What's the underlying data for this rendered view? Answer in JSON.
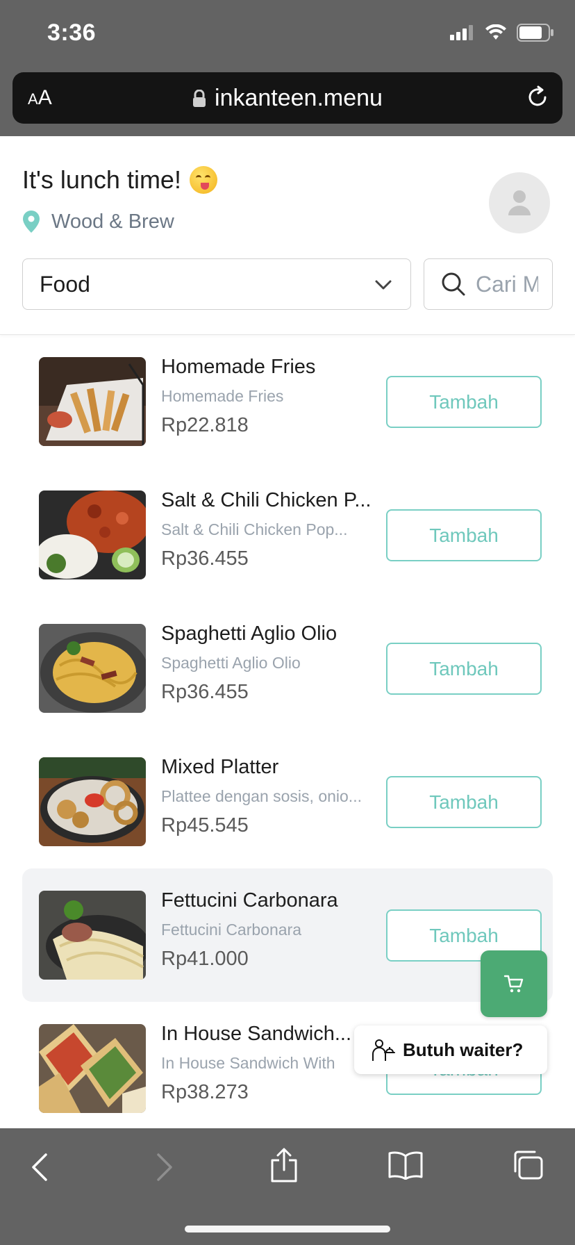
{
  "status_bar": {
    "time": "3:36"
  },
  "browser": {
    "text_size_label_small": "A",
    "text_size_label_large": "A",
    "url": "inkanteen.menu"
  },
  "header": {
    "greeting": "It's lunch time!",
    "location": "Wood & Brew",
    "category_selected": "Food",
    "search_placeholder": "Cari Menu"
  },
  "menu_items": [
    {
      "name": "Homemade Fries",
      "desc": "Homemade Fries",
      "price": "Rp22.818",
      "button": "Tambah",
      "image": "fries-photo"
    },
    {
      "name": "Salt & Chili Chicken P...",
      "desc": "Salt & Chili Chicken Pop...",
      "price": "Rp36.455",
      "button": "Tambah",
      "image": "chicken-rice-photo"
    },
    {
      "name": "Spaghetti Aglio Olio",
      "desc": "Spaghetti Aglio Olio",
      "price": "Rp36.455",
      "button": "Tambah",
      "image": "spaghetti-photo"
    },
    {
      "name": "Mixed Platter",
      "desc": "Plattee dengan sosis, onio...",
      "price": "Rp45.545",
      "button": "Tambah",
      "image": "platter-photo"
    },
    {
      "name": "Fettucini Carbonara",
      "desc": "Fettucini Carbonara",
      "price": "Rp41.000",
      "button": "Tambah",
      "image": "carbonara-photo"
    },
    {
      "name": "In House Sandwich...",
      "desc": "In House Sandwich With",
      "price": "Rp38.273",
      "button": "Tambah",
      "image": "sandwich-photo"
    }
  ],
  "floating": {
    "waiter_label": "Butuh waiter?"
  },
  "colors": {
    "accent": "#6fc8bc",
    "cart": "#4caa74",
    "pin": "#79cfc4"
  }
}
